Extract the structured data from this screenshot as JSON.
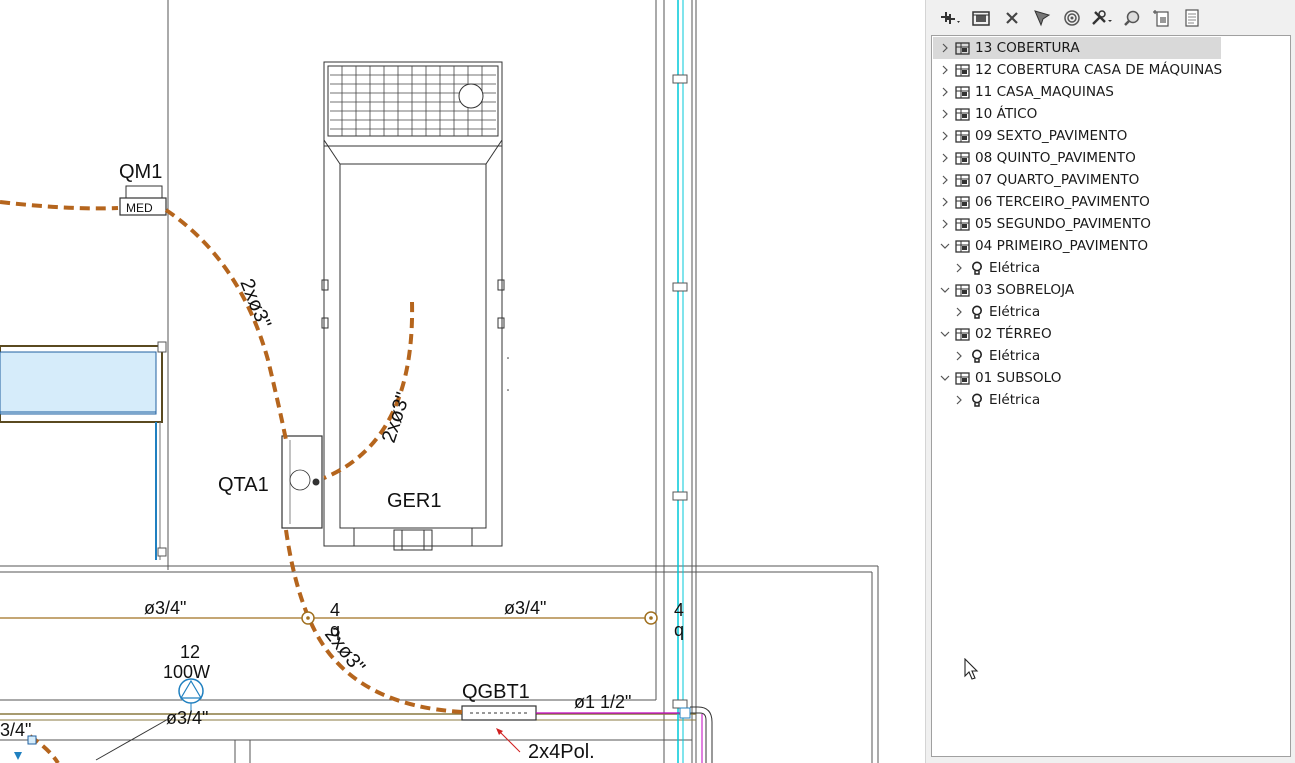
{
  "drawing": {
    "labels": {
      "qm1": "QM1",
      "med": "MED",
      "qta1": "QTA1",
      "ger1": "GER1",
      "qgbt1": "QGBT1",
      "pol": "2x4Pol.",
      "circuit_left": "2xø3\"",
      "circuit_center": "2xø3\"",
      "circuit_bottom": "2xø3\"",
      "conduit_1": "ø3/4\"",
      "conduit_2": "ø3/4\"",
      "conduit_3": "ø3/4\"",
      "conduit_partial": "3/4\"",
      "conduit_main": "ø1 1/2\"",
      "lamp_count_1": "4",
      "lamp_q_1": "q",
      "lamp_count_2": "4",
      "lamp_q_2": "q",
      "fixture_count": "12",
      "fixture_power": "100W"
    }
  },
  "toolbar": {
    "buttons": [
      {
        "name": "add-view-button",
        "icon": "add-dropdown-icon"
      },
      {
        "name": "layer-properties-button",
        "icon": "layer-properties-icon"
      },
      {
        "name": "delete-button",
        "icon": "close-x-icon"
      },
      {
        "name": "filter-button",
        "icon": "funnel-icon"
      },
      {
        "name": "visibility-button",
        "icon": "target-icon"
      },
      {
        "name": "tools-button",
        "icon": "wrench-dropdown-icon"
      },
      {
        "name": "find-button",
        "icon": "magnifier-icon"
      },
      {
        "name": "page-setup-button",
        "icon": "page-crop-icon"
      },
      {
        "name": "document-button",
        "icon": "document-icon"
      }
    ]
  },
  "tree": {
    "items": [
      {
        "label": "13 COBERTURA",
        "level": 0,
        "expanded": false,
        "icon": "floor-plan-icon",
        "selected": true
      },
      {
        "label": "12 COBERTURA CASA DE MÁQUINAS",
        "level": 0,
        "expanded": false,
        "icon": "floor-plan-icon"
      },
      {
        "label": "11 CASA_MAQUINAS",
        "level": 0,
        "expanded": false,
        "icon": "floor-plan-icon"
      },
      {
        "label": "10 ÁTICO",
        "level": 0,
        "expanded": false,
        "icon": "floor-plan-icon"
      },
      {
        "label": "09 SEXTO_PAVIMENTO",
        "level": 0,
        "expanded": false,
        "icon": "floor-plan-icon"
      },
      {
        "label": "08 QUINTO_PAVIMENTO",
        "level": 0,
        "expanded": false,
        "icon": "floor-plan-icon"
      },
      {
        "label": "07 QUARTO_PAVIMENTO",
        "level": 0,
        "expanded": false,
        "icon": "floor-plan-icon"
      },
      {
        "label": "06 TERCEIRO_PAVIMENTO",
        "level": 0,
        "expanded": false,
        "icon": "floor-plan-icon"
      },
      {
        "label": "05 SEGUNDO_PAVIMENTO",
        "level": 0,
        "expanded": false,
        "icon": "floor-plan-icon"
      },
      {
        "label": "04 PRIMEIRO_PAVIMENTO",
        "level": 0,
        "expanded": true,
        "icon": "floor-plan-icon"
      },
      {
        "label": "Elétrica",
        "level": 1,
        "expanded": false,
        "icon": "lightbulb-icon"
      },
      {
        "label": "03 SOBRELOJA",
        "level": 0,
        "expanded": true,
        "icon": "floor-plan-icon"
      },
      {
        "label": "Elétrica",
        "level": 1,
        "expanded": false,
        "icon": "lightbulb-icon"
      },
      {
        "label": "02 TÉRREO",
        "level": 0,
        "expanded": true,
        "icon": "floor-plan-icon"
      },
      {
        "label": "Elétrica",
        "level": 1,
        "expanded": false,
        "icon": "lightbulb-icon"
      },
      {
        "label": "01 SUBSOLO",
        "level": 0,
        "expanded": true,
        "icon": "floor-plan-icon"
      },
      {
        "label": "Elétrica",
        "level": 1,
        "expanded": false,
        "icon": "lightbulb-icon"
      }
    ]
  },
  "colors": {
    "circuit": "#b5651d",
    "conduit": "#a07020",
    "wall": "#4a4a4a",
    "cyan": "#00c8d8",
    "blue_fill": "#cfe8f8",
    "magenta": "#c000c0",
    "leader": "#d02020",
    "selection": "#d9d9d9"
  }
}
